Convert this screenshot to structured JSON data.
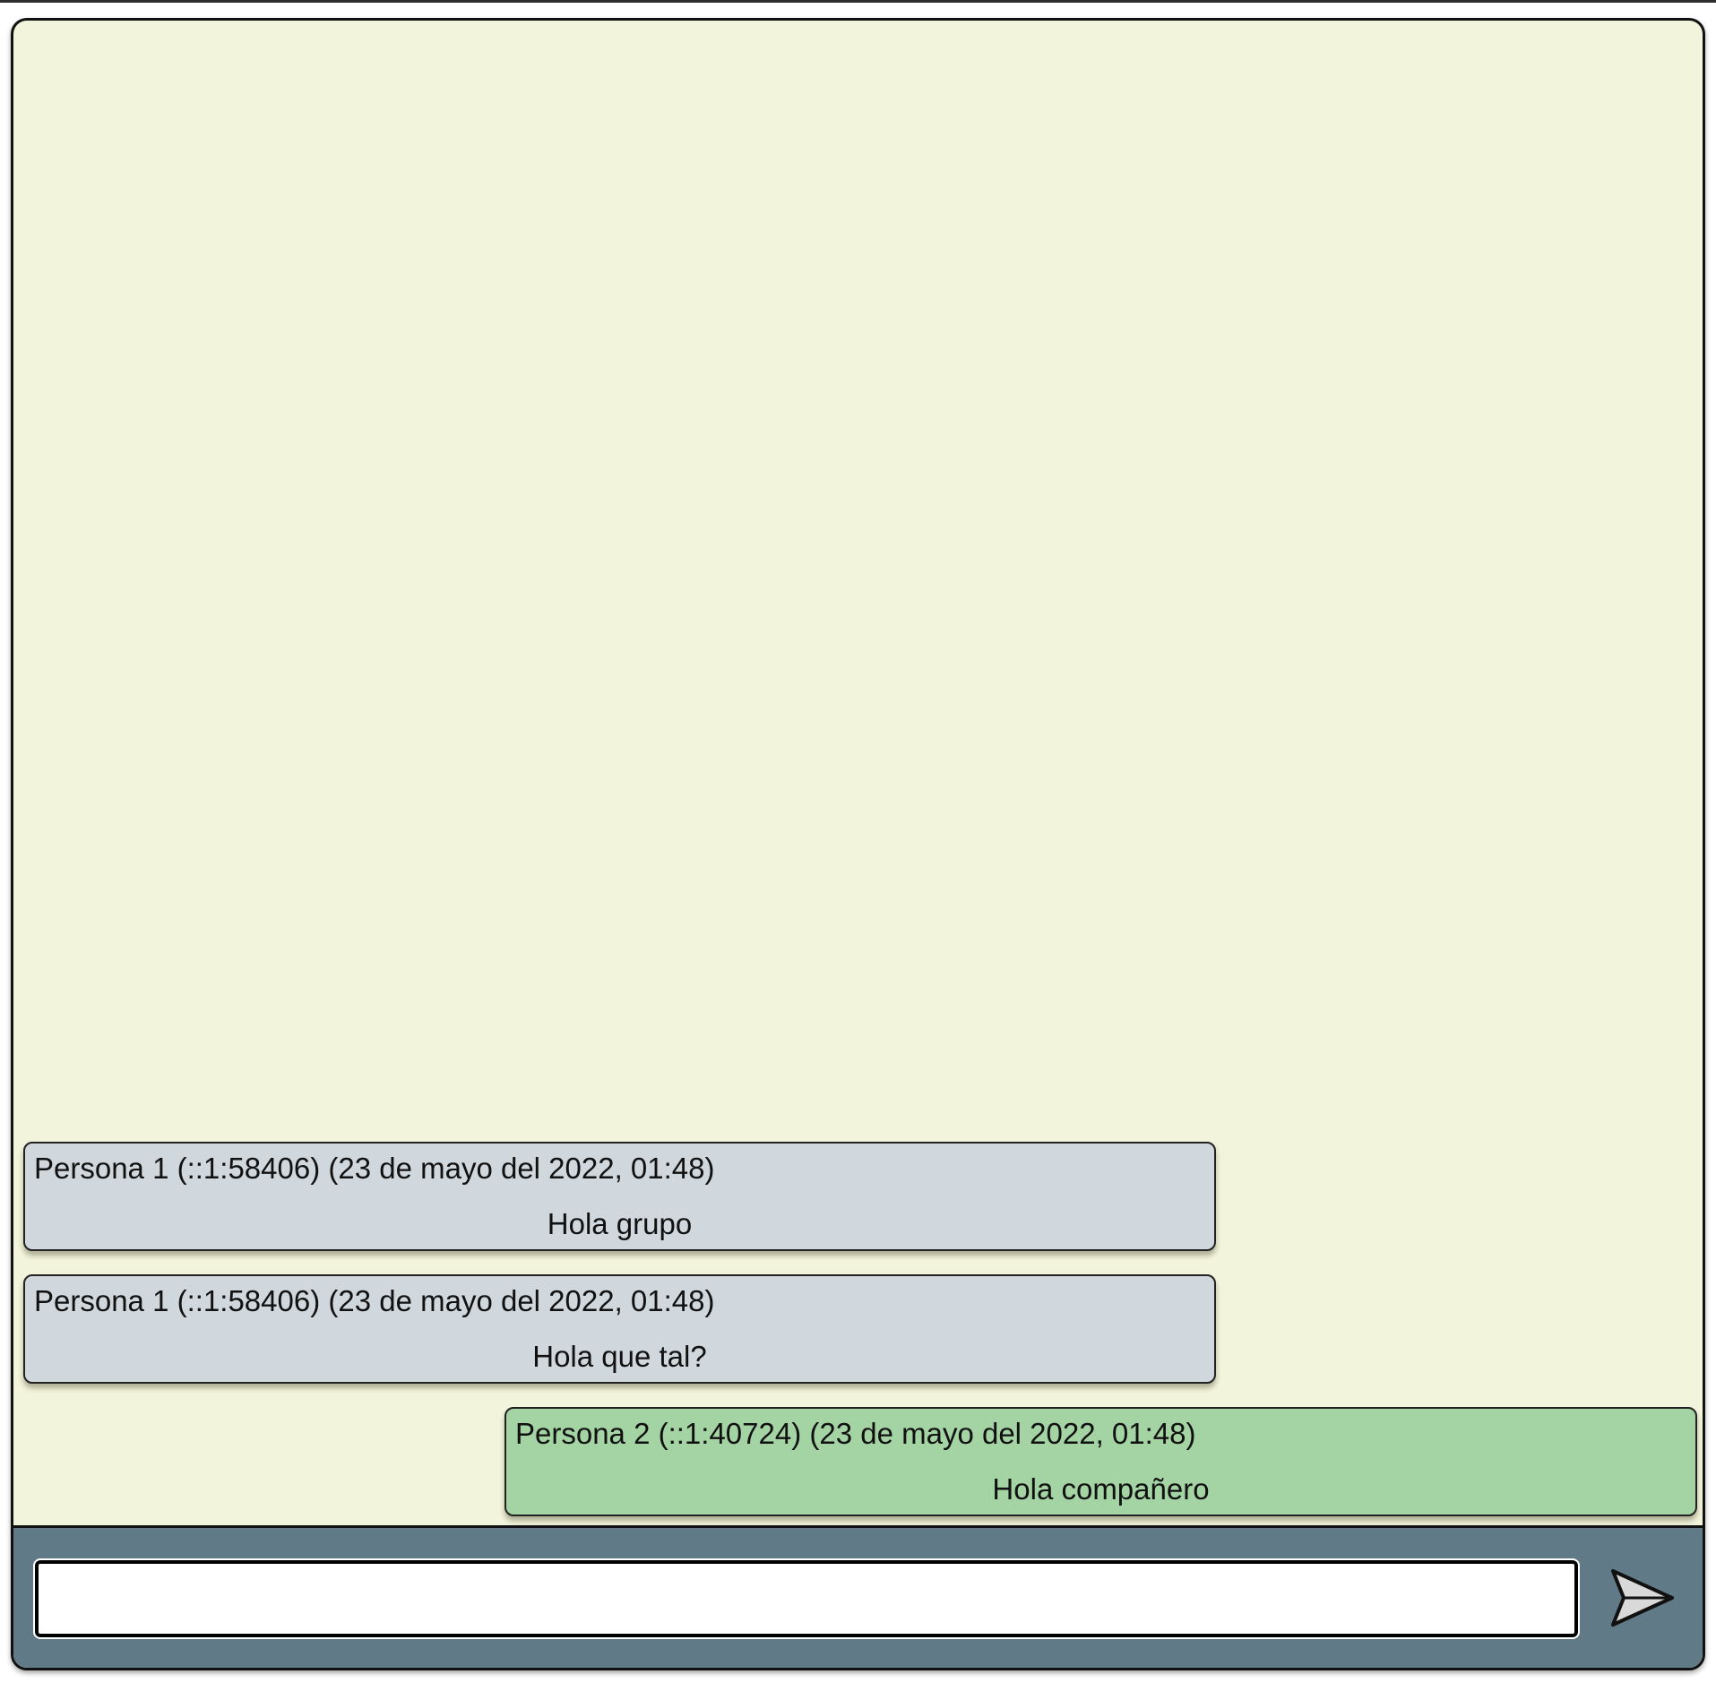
{
  "composer": {
    "input_value": "",
    "input_placeholder": "",
    "send_icon": "send-arrow-icon"
  },
  "messages": [
    {
      "sender": "Persona 1 (::1:58406) (23 de mayo del 2022, 01:48)",
      "text": "Hola grupo",
      "side": "other"
    },
    {
      "sender": "Persona 1 (::1:58406) (23 de mayo del 2022, 01:48)",
      "text": "Hola que tal?",
      "side": "other"
    },
    {
      "sender": "Persona 2 (::1:40724) (23 de mayo del 2022, 01:48)",
      "text": "Hola compañero",
      "side": "self"
    }
  ],
  "colors": {
    "chat_background": "#f3f4dc",
    "other_bubble": "#d0d8de",
    "self_bubble": "#a4d4a4",
    "composer_bar": "#607a87"
  }
}
